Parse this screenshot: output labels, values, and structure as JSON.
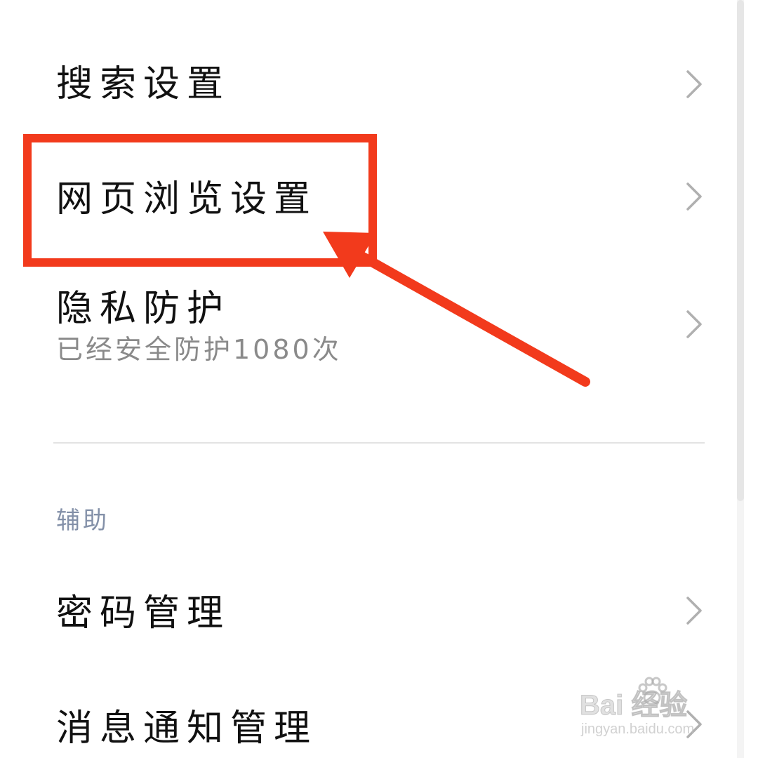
{
  "settings": {
    "items": [
      {
        "label": "搜索设置"
      },
      {
        "label": "网页浏览设置"
      },
      {
        "label": "隐私防护",
        "sublabel": "已经安全防护1080次"
      },
      {
        "label": "密码管理"
      },
      {
        "label": "消息通知管理"
      }
    ],
    "section_header": "辅助"
  },
  "annotation": {
    "highlight_color": "#f23a1c",
    "highlighted_item": "网页浏览设置"
  },
  "watermark": {
    "brand": "Bai  经验",
    "url": "jingyan.baidu.com"
  },
  "colors": {
    "primary_text": "#111111",
    "secondary_text": "#8a8a8a",
    "section_header": "#8390a8",
    "chevron": "#b0b0b0",
    "divider": "#e3e3e3"
  }
}
